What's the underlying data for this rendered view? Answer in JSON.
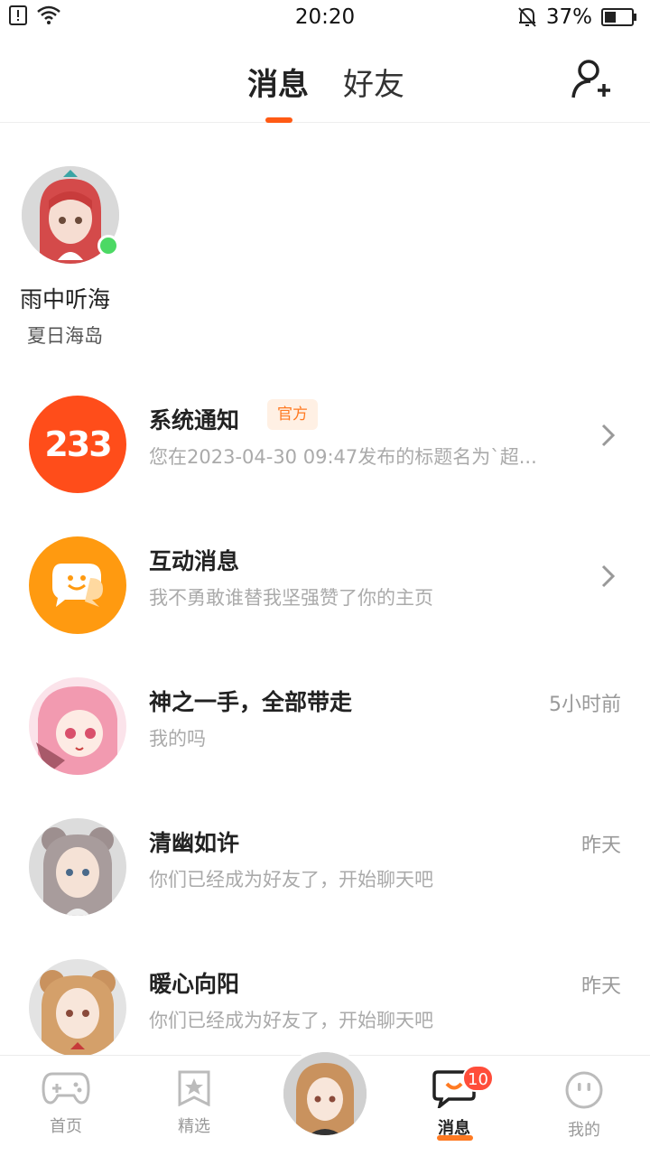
{
  "status_bar": {
    "time": "20:20",
    "battery": "37%",
    "icons": [
      "alert-icon",
      "wifi-icon",
      "mute-icon",
      "battery-icon"
    ]
  },
  "header": {
    "tabs": [
      {
        "label": "消息",
        "active": true
      },
      {
        "label": "好友",
        "active": false
      }
    ],
    "add_friend_icon": "add-person-icon"
  },
  "online_friend": {
    "name": "雨中听海",
    "subtitle": "夏日海岛",
    "online": true
  },
  "conversations": [
    {
      "title": "系统通知",
      "badge": "官方",
      "preview": "您在2023-04-30 09:47发布的标题名为`超...",
      "time": "",
      "has_chevron": true,
      "avatar": "233"
    },
    {
      "title": "互动消息",
      "badge": "",
      "preview": "我不勇敢谁替我坚强赞了你的主页",
      "time": "",
      "has_chevron": true,
      "avatar": "chat-bubble-icon"
    },
    {
      "title": "神之一手，全部带走",
      "badge": "",
      "preview": "我的吗",
      "time": "5小时前",
      "has_chevron": false,
      "avatar": "anime-girl-pink"
    },
    {
      "title": "清幽如许",
      "badge": "",
      "preview": "你们已经成为好友了，开始聊天吧",
      "time": "昨天",
      "has_chevron": false,
      "avatar": "anime-girl-gray"
    },
    {
      "title": "暖心向阳",
      "badge": "",
      "preview": "你们已经成为好友了，开始聊天吧",
      "time": "昨天",
      "has_chevron": false,
      "avatar": "anime-girl-brown"
    }
  ],
  "bottom_nav": {
    "items": [
      {
        "label": "首页",
        "icon": "gamepad-icon"
      },
      {
        "label": "精选",
        "icon": "star-card-icon"
      },
      {
        "label": "",
        "icon": "avatar-center"
      },
      {
        "label": "消息",
        "icon": "message-smile-icon",
        "badge": "10",
        "active": true
      },
      {
        "label": "我的",
        "icon": "face-icon"
      }
    ]
  },
  "colors": {
    "accent": "#ff5a14",
    "online": "#4cd964",
    "badge": "#ff4d3a"
  }
}
